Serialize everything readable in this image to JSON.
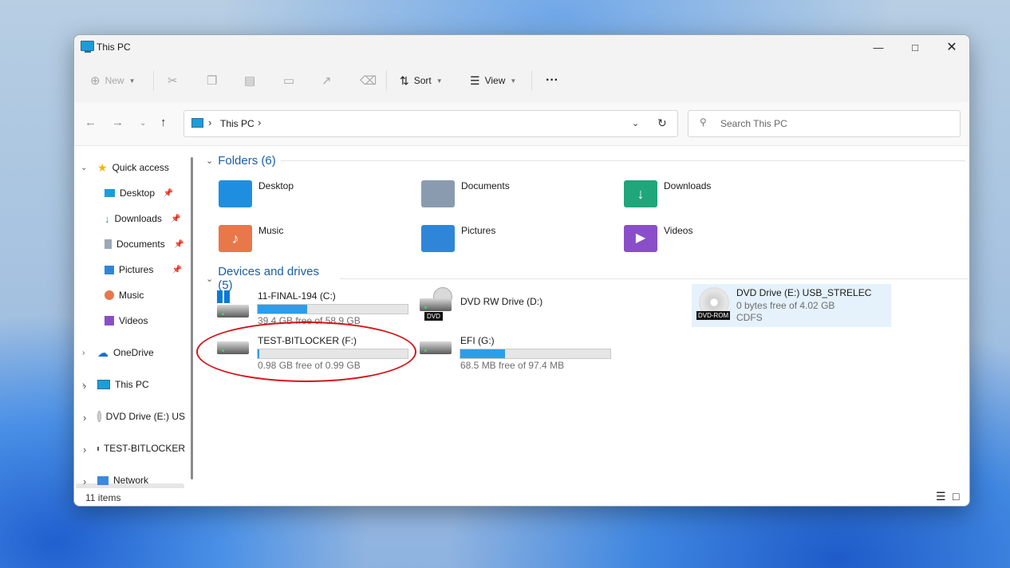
{
  "window": {
    "title": "This PC"
  },
  "toolbar": {
    "new": "New",
    "sort": "Sort",
    "view": "View",
    "more": "···"
  },
  "address": {
    "crumb": "This PC",
    "search_placeholder": "Search This PC"
  },
  "nav": {
    "quick_access": "Quick access",
    "items": [
      {
        "label": "Desktop",
        "icon": "desktop-icon"
      },
      {
        "label": "Downloads",
        "icon": "download-icon"
      },
      {
        "label": "Documents",
        "icon": "document-icon"
      },
      {
        "label": "Pictures",
        "icon": "picture-icon"
      },
      {
        "label": "Music",
        "icon": "music-icon"
      },
      {
        "label": "Videos",
        "icon": "video-icon"
      }
    ],
    "onedrive": "OneDrive",
    "this_pc": "This PC",
    "dvd": "DVD Drive (E:) US",
    "bitlocker": "TEST-BITLOCKER",
    "network": "Network"
  },
  "folders": {
    "heading": "Folders (6)",
    "items": [
      {
        "label": "Desktop",
        "color": "#1e8fe0"
      },
      {
        "label": "Documents",
        "color": "#8a9bb0"
      },
      {
        "label": "Downloads",
        "color": "#1fa67a"
      },
      {
        "label": "Music",
        "color": "#e8774a"
      },
      {
        "label": "Pictures",
        "color": "#2f86d8"
      },
      {
        "label": "Videos",
        "color": "#8a4fc8"
      }
    ]
  },
  "drives": {
    "heading": "Devices and drives (5)",
    "c": {
      "name": "11-FINAL-194 (C:)",
      "info": "39.4 GB free of 58.9 GB",
      "used_fraction": 0.33
    },
    "d": {
      "name": "DVD RW Drive (D:)",
      "badge": "DVD"
    },
    "e": {
      "name": "DVD Drive (E:) USB_STRELEC",
      "info": "0 bytes free of 4.02 GB",
      "fs": "CDFS",
      "badge": "DVD-ROM"
    },
    "f": {
      "name": "TEST-BITLOCKER (F:)",
      "info": "0.98 GB free of 0.99 GB",
      "used_fraction": 0.01
    },
    "g": {
      "name": "EFI (G:)",
      "info": "68.5 MB free of 97.4 MB",
      "used_fraction": 0.3
    }
  },
  "status": {
    "items": "11 items"
  },
  "colors": {
    "accent": "#1a5ea8",
    "bar": "#2b9ee8",
    "highlight": "#d4141b",
    "selection": "#e5f1fb"
  }
}
